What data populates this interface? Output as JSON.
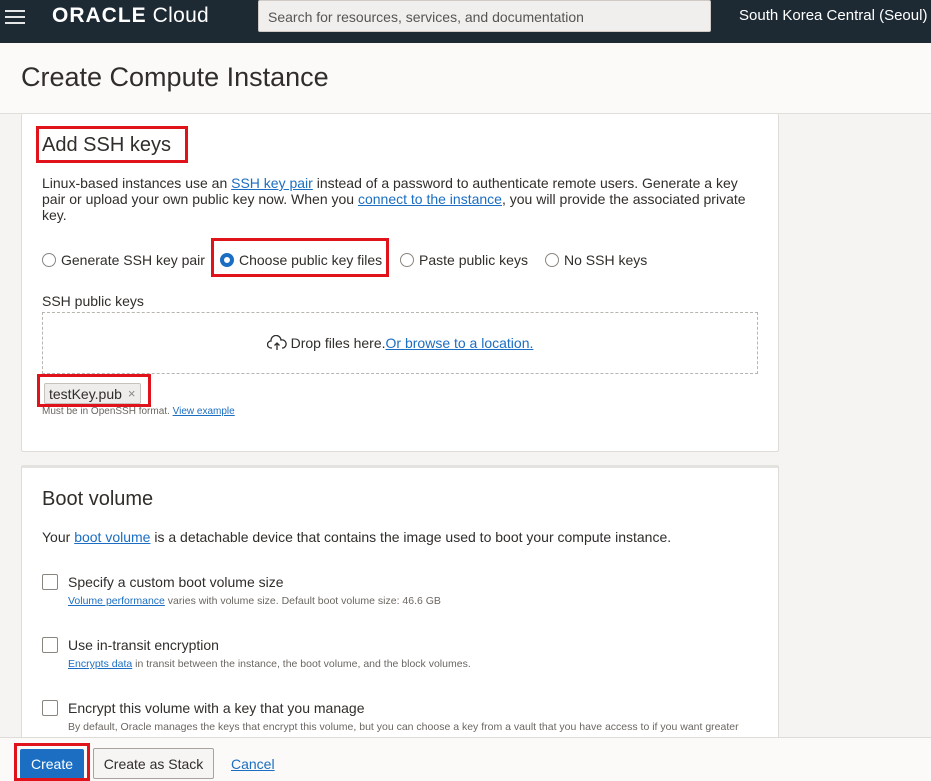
{
  "topbar": {
    "logo_brand": "ORACLE",
    "logo_product": "Cloud",
    "search_placeholder": "Search for resources, services, and documentation",
    "region": "South Korea Central (Seoul)"
  },
  "page": {
    "title": "Create Compute Instance"
  },
  "ssh": {
    "title": "Add SSH keys",
    "desc_1": "Linux-based instances use an ",
    "desc_link1": "SSH key pair",
    "desc_2": " instead of a password to authenticate remote users. Generate a key pair or upload your own public key now. When you ",
    "desc_link2": "connect to the instance",
    "desc_3": ", you will provide the associated private key.",
    "options": [
      {
        "label": "Generate SSH key pair",
        "selected": false
      },
      {
        "label": "Choose public key files",
        "selected": true
      },
      {
        "label": "Paste public keys",
        "selected": false
      },
      {
        "label": "No SSH keys",
        "selected": false
      }
    ],
    "keys_label": "SSH public keys",
    "drop_text": "Drop files here. ",
    "browse_link": "Or browse to a location.",
    "file_chip": "testKey.pub",
    "file_remove": "×",
    "hint_text": "Must be in OpenSSH format. ",
    "hint_link": "View example"
  },
  "boot": {
    "title": "Boot volume",
    "desc_1": "Your ",
    "desc_link": "boot volume",
    "desc_2": " is a detachable device that contains the image used to boot your compute instance.",
    "options": [
      {
        "label": "Specify a custom boot volume size",
        "sub_link": "Volume performance",
        "sub_text": " varies with volume size. Default boot volume size: 46.6 GB",
        "checked": false
      },
      {
        "label": "Use in-transit encryption",
        "sub_link": "Encrypts data",
        "sub_text": " in transit between the instance, the boot volume, and the block volumes.",
        "checked": false
      },
      {
        "label": "Encrypt this volume with a key that you manage",
        "sub_link": "",
        "sub_text": "By default, Oracle manages the keys that encrypt this volume, but you can choose a key from a vault that you have access to if you want greater",
        "checked": false
      }
    ]
  },
  "footer": {
    "create": "Create",
    "create_stack": "Create as Stack",
    "cancel": "Cancel"
  },
  "colors": {
    "accent": "#1b6ec2",
    "topbar": "#1e2a33",
    "highlight": "#e0131b"
  }
}
